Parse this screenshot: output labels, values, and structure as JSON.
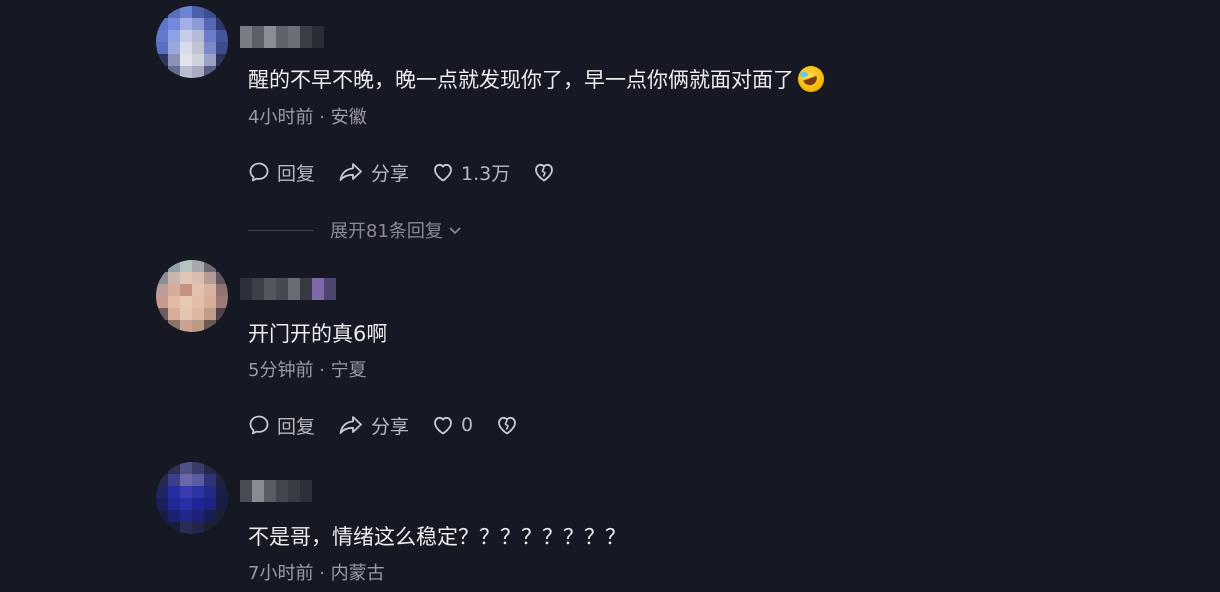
{
  "comments": [
    {
      "text": "醒的不早不晚，晚一点就发现你了，早一点你俩就面对面了",
      "emoji": "rolling-on-floor-laughing-emoji",
      "time": "4小时前",
      "location": "安徽",
      "reply_label": "回复",
      "share_label": "分享",
      "likes": "1.3万",
      "expand_label": "展开81条回复"
    },
    {
      "text": "开门开的真6啊",
      "time": "5分钟前",
      "location": "宁夏",
      "reply_label": "回复",
      "share_label": "分享",
      "likes": "0"
    },
    {
      "text": "不是哥，情绪这么稳定？？？？？？？？",
      "time": "7小时前",
      "location": "内蒙古"
    }
  ],
  "separator": "·",
  "icons": {
    "reply": "comment-bubble-icon",
    "share": "share-arrow-icon",
    "like": "heart-icon",
    "dislike": "broken-heart-icon",
    "expand": "chevron-down-icon"
  },
  "colors": {
    "background": "#161823",
    "text": "#ececee",
    "meta": "#9a9ba3"
  }
}
